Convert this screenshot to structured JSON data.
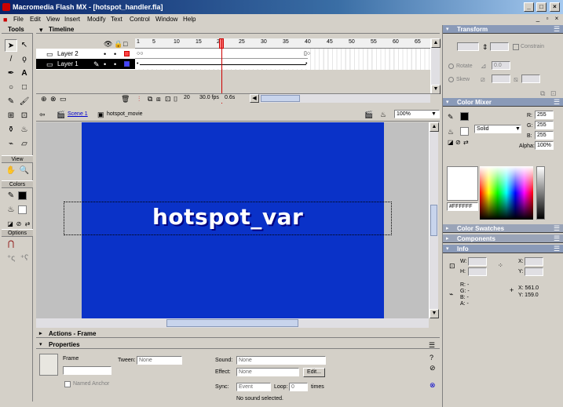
{
  "window": {
    "title": "Macromedia Flash MX - [hotspot_handler.fla]"
  },
  "menu": [
    "File",
    "Edit",
    "View",
    "Insert",
    "Modify",
    "Text",
    "Control",
    "Window",
    "Help"
  ],
  "tools": {
    "header": "Tools",
    "sections": {
      "view": "View",
      "colors": "Colors",
      "options": "Options"
    }
  },
  "timeline": {
    "header": "Timeline",
    "layers": [
      {
        "name": "Layer 2",
        "selected": false
      },
      {
        "name": "Layer 1",
        "selected": true
      }
    ],
    "ruler": [
      "1",
      "5",
      "10",
      "15",
      "20",
      "25",
      "30",
      "35",
      "40",
      "45",
      "50",
      "55",
      "60",
      "65"
    ],
    "current_frame": "20",
    "fps": "30.0 fps",
    "time": "0.6s"
  },
  "editbar": {
    "scene": "Scene 1",
    "symbol": "hotspot_movie",
    "zoom": "100%"
  },
  "stage": {
    "text": "hotspot_var",
    "background": "#0a32c8"
  },
  "actions": {
    "header": "Actions - Frame"
  },
  "properties": {
    "header": "Properties",
    "frame_label": "Frame",
    "named_anchor": "Named Anchor",
    "tween_label": "Tween:",
    "tween_value": "None",
    "sound_label": "Sound:",
    "sound_value": "None",
    "effect_label": "Effect:",
    "effect_value": "None",
    "edit_button": "Edit...",
    "sync_label": "Sync:",
    "sync_value": "Event",
    "loop_label": "Loop:",
    "loop_value": "0",
    "times_label": "times",
    "status": "No sound selected."
  },
  "transform": {
    "header": "Transform",
    "constrain": "Constrain",
    "rotate": "Rotate",
    "rotate_value": "0.0",
    "skew": "Skew"
  },
  "color_mixer": {
    "header": "Color Mixer",
    "r": "255",
    "g": "255",
    "b": "255",
    "fill_type": "Solid",
    "alpha": "100%",
    "hex": "#FFFFFF"
  },
  "color_swatches": {
    "header": "Color Swatches"
  },
  "components": {
    "header": "Components"
  },
  "info": {
    "header": "Info",
    "w_label": "W:",
    "h_label": "H:",
    "x_label": "X:",
    "y_label": "Y:",
    "r_label": "R: -",
    "g_label": "G: -",
    "b_label": "B: -",
    "a_label": "A: -",
    "cursor_x": "X: 561.0",
    "cursor_y": "Y: 159.0"
  }
}
